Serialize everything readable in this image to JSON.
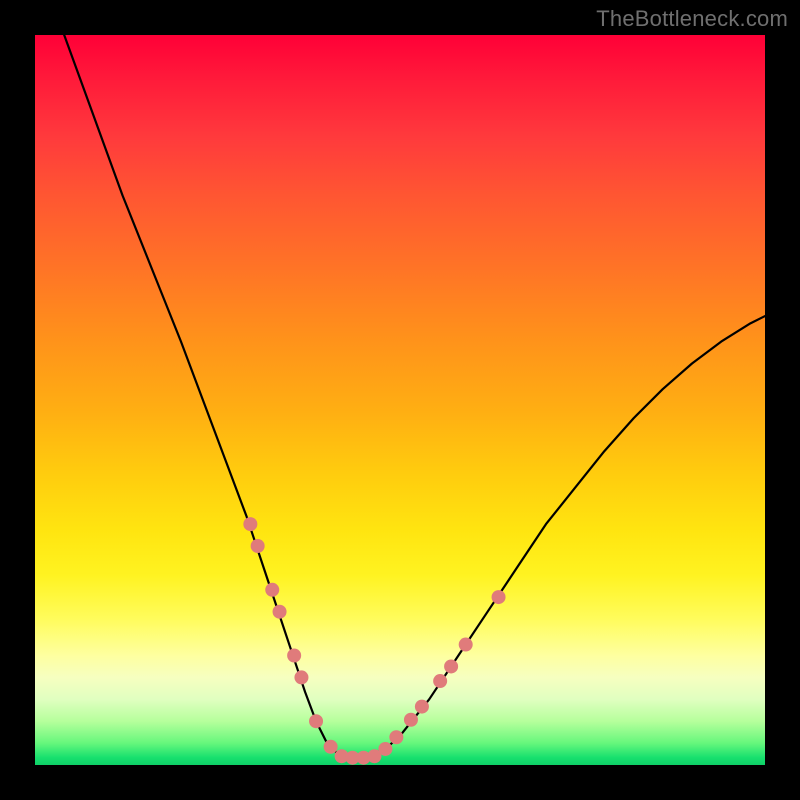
{
  "watermark": "TheBottleneck.com",
  "chart_data": {
    "type": "line",
    "title": "",
    "xlabel": "",
    "ylabel": "",
    "xlim": [
      0,
      100
    ],
    "ylim": [
      0,
      100
    ],
    "grid": false,
    "series": [
      {
        "name": "bottleneck-curve",
        "color": "#000000",
        "width": 2.2,
        "x": [
          4,
          8,
          12,
          16,
          20,
          23,
          26,
          29,
          31,
          33,
          35,
          37,
          38.5,
          40,
          41.5,
          43,
          44.5,
          46,
          48,
          50,
          54,
          58,
          62,
          66,
          70,
          74,
          78,
          82,
          86,
          90,
          94,
          98,
          100
        ],
        "y": [
          100,
          89,
          78,
          68,
          58,
          50,
          42,
          34,
          28,
          22,
          16,
          10,
          6,
          3,
          1.5,
          1,
          1,
          1.3,
          2.2,
          4,
          9,
          15,
          21,
          27,
          33,
          38,
          43,
          47.5,
          51.5,
          55,
          58,
          60.5,
          61.5
        ]
      }
    ],
    "markers": {
      "name": "highlight-dots",
      "color": "#e07b7b",
      "radius": 7,
      "points": [
        {
          "x": 29.5,
          "y": 33
        },
        {
          "x": 30.5,
          "y": 30
        },
        {
          "x": 32.5,
          "y": 24
        },
        {
          "x": 33.5,
          "y": 21
        },
        {
          "x": 35.5,
          "y": 15
        },
        {
          "x": 36.5,
          "y": 12
        },
        {
          "x": 38.5,
          "y": 6
        },
        {
          "x": 40.5,
          "y": 2.5
        },
        {
          "x": 42.0,
          "y": 1.2
        },
        {
          "x": 43.5,
          "y": 1.0
        },
        {
          "x": 45.0,
          "y": 1.0
        },
        {
          "x": 46.5,
          "y": 1.2
        },
        {
          "x": 48.0,
          "y": 2.2
        },
        {
          "x": 49.5,
          "y": 3.8
        },
        {
          "x": 51.5,
          "y": 6.2
        },
        {
          "x": 53.0,
          "y": 8.0
        },
        {
          "x": 55.5,
          "y": 11.5
        },
        {
          "x": 57.0,
          "y": 13.5
        },
        {
          "x": 59.0,
          "y": 16.5
        },
        {
          "x": 63.5,
          "y": 23
        }
      ]
    }
  }
}
